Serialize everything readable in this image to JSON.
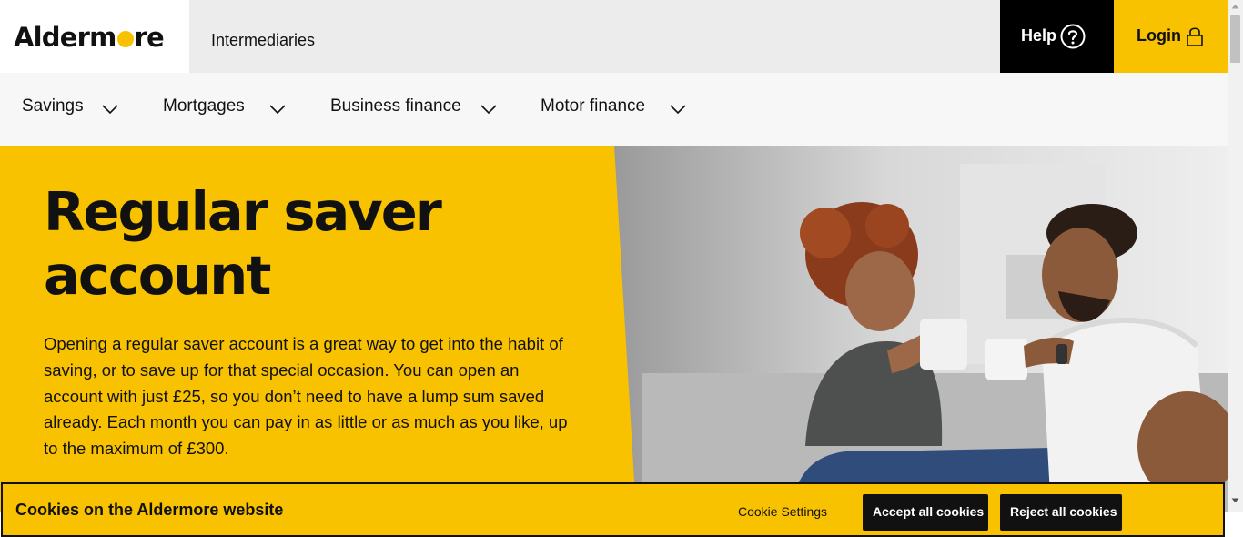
{
  "header": {
    "logo_text": "Aldermore",
    "segment_link": "Intermediaries",
    "help_label": "Help",
    "help_icon": "question-circle-icon",
    "login_label": "Login",
    "login_icon": "padlock-icon"
  },
  "nav": {
    "items": [
      {
        "label": "Savings",
        "icon": "chevron-down-icon"
      },
      {
        "label": "Mortgages",
        "icon": "chevron-down-icon"
      },
      {
        "label": "Business finance",
        "icon": "chevron-down-icon"
      },
      {
        "label": "Motor finance",
        "icon": "chevron-down-icon"
      }
    ]
  },
  "hero": {
    "title_line1": "Regular saver",
    "title_line2": "account",
    "description": "Opening a regular saver account is a great way to get into the habit of saving, or to save up for that special occasion. You can open an account with just £25, so you don’t need to have a lump sum saved already. Each month you can pay in as little or as much as you like, up to the maximum of £300."
  },
  "cookie_banner": {
    "title": "Cookies on the Aldermore website",
    "settings_link": "Cookie Settings",
    "accept_label": "Accept all cookies",
    "reject_label": "Reject all cookies"
  },
  "colors": {
    "brand_yellow": "#f9c200",
    "black": "#000000",
    "segment_grey": "#ececec",
    "nav_background": "#f7f7f7"
  }
}
